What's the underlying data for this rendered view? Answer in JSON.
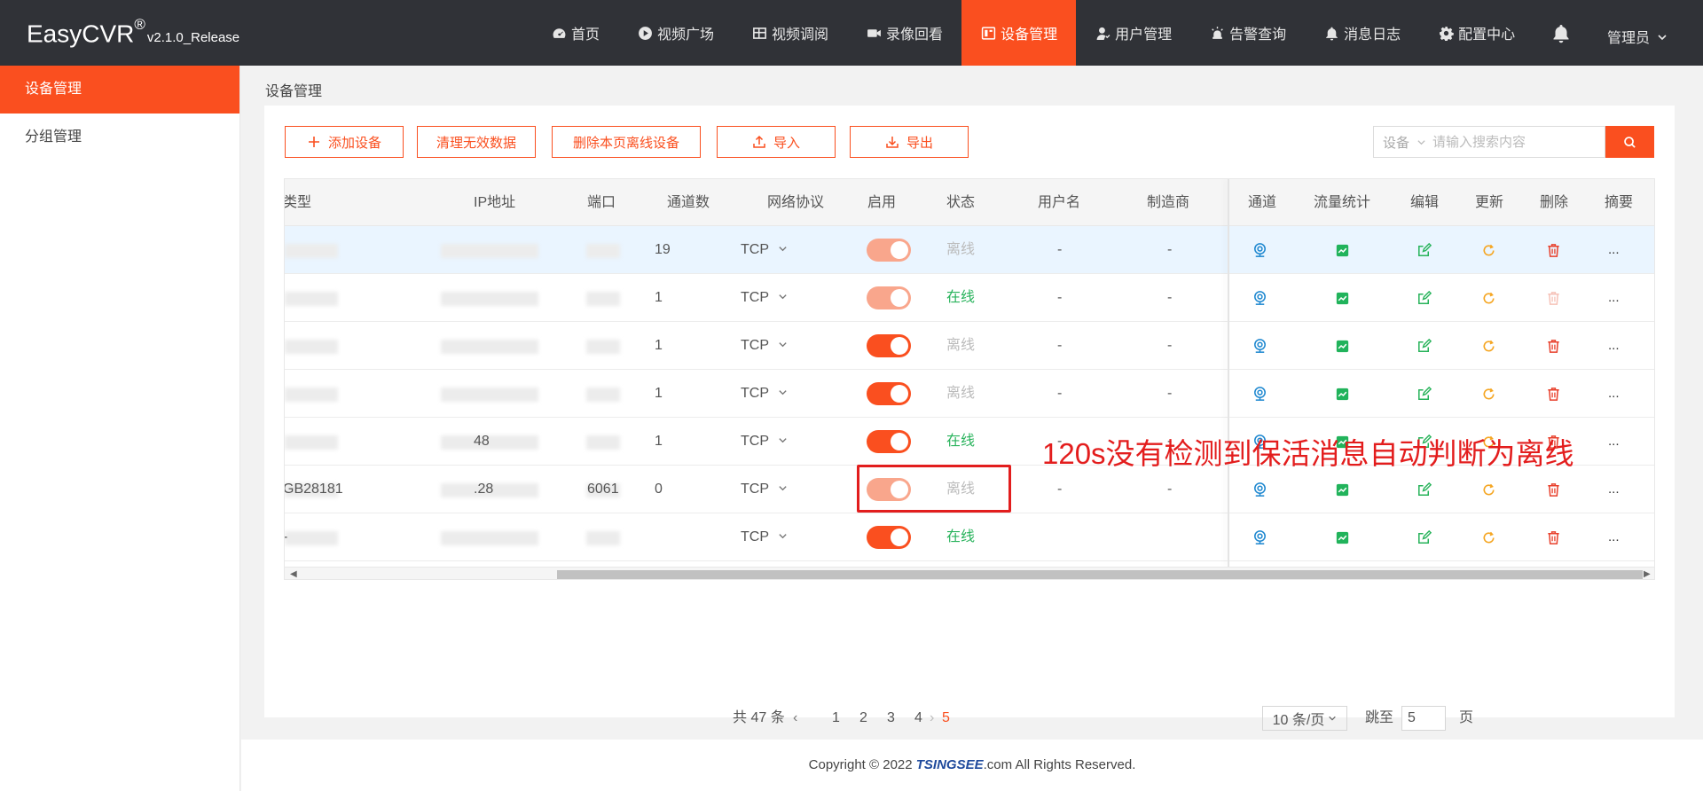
{
  "app": {
    "name": "EasyCVR",
    "reg": "®",
    "version": "v2.1.0_Release"
  },
  "nav": [
    {
      "label": "首页",
      "icon": "dashboard-icon"
    },
    {
      "label": "视频广场",
      "icon": "play-circle-icon"
    },
    {
      "label": "视频调阅",
      "icon": "grid-icon"
    },
    {
      "label": "录像回看",
      "icon": "video-camera-icon"
    },
    {
      "label": "设备管理",
      "icon": "device-icon",
      "active": true
    },
    {
      "label": "用户管理",
      "icon": "user-icon"
    },
    {
      "label": "告警查询",
      "icon": "alarm-icon"
    },
    {
      "label": "消息日志",
      "icon": "bell-small-icon"
    },
    {
      "label": "配置中心",
      "icon": "gear-icon"
    }
  ],
  "user": "管理员",
  "sidebar": {
    "items": [
      {
        "label": "设备管理"
      },
      {
        "label": "分组管理"
      }
    ]
  },
  "breadcrumb": "设备管理",
  "toolbar": {
    "add": "添加设备",
    "clean": "清理无效数据",
    "delete_offline": "删除本页离线设备",
    "import": "导入",
    "export": "导出"
  },
  "search": {
    "select": "设备",
    "placeholder": "请输入搜索内容"
  },
  "table": {
    "headers": {
      "type": "类型",
      "ip": "IP地址",
      "port": "端口",
      "channels": "通道数",
      "protocol": "网络协议",
      "enabled": "启用",
      "status": "状态",
      "username": "用户名",
      "maker": "制造商",
      "channel": "通道",
      "traffic": "流量统计",
      "edit": "编辑",
      "update": "更新",
      "delete": "删除",
      "summary": "摘要"
    },
    "rows": [
      {
        "type": "",
        "ip": "",
        "port": "",
        "channels": "19",
        "protocol": "TCP",
        "enabled": "dim",
        "status": "离线",
        "status_kind": "off",
        "username": "-",
        "maker": "-",
        "highlight": true
      },
      {
        "type": "",
        "ip": "",
        "port": "",
        "channels": "1",
        "protocol": "TCP",
        "enabled": "dim",
        "status": "在线",
        "status_kind": "on",
        "username": "-",
        "maker": "-",
        "delete_disabled": true
      },
      {
        "type": "",
        "ip": "",
        "port": "",
        "channels": "1",
        "protocol": "TCP",
        "enabled": "on",
        "status": "离线",
        "status_kind": "off",
        "username": "-",
        "maker": "-"
      },
      {
        "type": "",
        "ip": "",
        "port": "",
        "channels": "1",
        "protocol": "TCP",
        "enabled": "on",
        "status": "离线",
        "status_kind": "off",
        "username": "-",
        "maker": "-"
      },
      {
        "type": "",
        "ip": "48",
        "port": "",
        "channels": "1",
        "protocol": "TCP",
        "enabled": "on",
        "status": "在线",
        "status_kind": "on",
        "username": "-",
        "maker": "-"
      },
      {
        "type": "GB28181",
        "ip": ".28",
        "port": "6061",
        "channels": "0",
        "protocol": "TCP",
        "enabled": "dim",
        "status": "离线",
        "status_kind": "off",
        "username": "-",
        "maker": "-"
      },
      {
        "type": "-",
        "ip": "",
        "port": "",
        "channels": "",
        "protocol": "TCP",
        "enabled": "on",
        "status": "在线",
        "status_kind": "on",
        "username": "",
        "maker": ""
      }
    ],
    "more": "..."
  },
  "annotation": "120s没有检测到保活消息自动判断为离线",
  "pagination": {
    "total": "共 47 条",
    "pages": [
      "1",
      "2",
      "3",
      "4",
      "5"
    ],
    "current": "5",
    "size": "10 条/页",
    "jump_label": "跳至",
    "jump_value": "5",
    "page_suffix": "页"
  },
  "footer": {
    "prefix": "Copyright © 2022 ",
    "brand": "TSINGSEE",
    "suffix": ".com All Rights Reserved."
  },
  "colors": {
    "accent": "#fa4f1f",
    "header": "#303237",
    "online": "#29b35c",
    "channel_icon": "#1e88d0",
    "traffic_icon": "#21b35b",
    "edit_icon": "#27b35a",
    "update_icon": "#f5a623",
    "delete_icon": "#e8402c",
    "annotation": "#e31d1d"
  }
}
